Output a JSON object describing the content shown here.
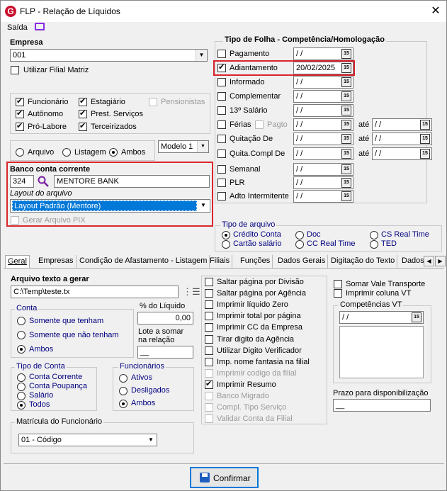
{
  "window": {
    "title": "FLP - Relação de Líquidos",
    "saida_label": "Saída"
  },
  "empresa": {
    "label": "Empresa",
    "value": "001",
    "filial_matriz": "Utilizar Filial Matriz"
  },
  "tipos": {
    "funcionario": "Funcionário",
    "autonomo": "Autônomo",
    "pro_labore": "Pró-Labore",
    "estagiario": "Estagiário",
    "prest_servicos": "Prest. Serviços",
    "terceirizados": "Terceirizados",
    "pensionistas": "Pensionistas"
  },
  "formato": {
    "arquivo": "Arquivo",
    "listagem": "Listagem",
    "ambos": "Ambos",
    "modelo": "Modelo 1"
  },
  "banco": {
    "title": "Banco conta corrente",
    "codigo": "324",
    "nome": "MENTORE BANK",
    "layout_label": "Layout do arquivo",
    "layout_value": "Layout Padrão (Mentore)",
    "gerar_pix": "Gerar Arquivo PIX"
  },
  "folha": {
    "title": "Tipo de Folha  -  Competência/Homologação",
    "ate": "até",
    "empty_date": " /  /",
    "rows": [
      {
        "label": "Pagamento",
        "date": " /  /",
        "checked": false
      },
      {
        "label": "Adiantamento",
        "date": "20/02/2025",
        "checked": true
      },
      {
        "label": "Informado",
        "date": " /  /",
        "checked": false
      },
      {
        "label": "Complementar",
        "date": " /  /",
        "checked": false
      },
      {
        "label": "13º Salário",
        "date": " /  /",
        "checked": false
      },
      {
        "label": "Férias",
        "date": " /  /",
        "checked": false,
        "extra": "Pagto"
      },
      {
        "label": "Quitação De",
        "date": " /  /",
        "checked": false
      },
      {
        "label": "Quita.Compl De",
        "date": " /  /",
        "checked": false
      },
      {
        "label": "Semanal",
        "date": " /  /",
        "checked": false
      },
      {
        "label": "PLR",
        "date": " /  /",
        "checked": false
      },
      {
        "label": "Adto Intermitente",
        "date": " /  /",
        "checked": false
      }
    ]
  },
  "tipo_arquivo": {
    "title": "Tipo de arquivo",
    "credito": "Crédito Conta",
    "cartao": "Cartão salário",
    "doc": "Doc",
    "cc_real": "CC Real Time",
    "cs_real": "CS Real Time",
    "ted": "TED"
  },
  "tabs": [
    "Geral",
    "Empresas",
    "Condição de Afastamento - Listagem",
    "Filiais",
    "Funções",
    "Dados Gerais",
    "Digitação do Texto",
    "Dados"
  ],
  "geral": {
    "arquivo_label": "Arquivo texto a gerar",
    "arquivo_value": "C:\\Temp\\teste.tx",
    "conta_title": "Conta",
    "conta_opts": [
      "Somente que tenham",
      "Somente que não tenham",
      "Ambos"
    ],
    "pct_label": "% do Líquido",
    "pct_value": "0,00",
    "lote_label": "Lote a somar na relação",
    "lote_value": "__",
    "tipo_conta_title": "Tipo de Conta",
    "tipo_conta_opts": [
      "Conta Corrente",
      "Conta Poupança",
      "Salário",
      "Todos"
    ],
    "funcionarios_title": "Funcionários",
    "func_opts": [
      "Ativos",
      "Desligados",
      "Ambos"
    ],
    "matricula_title": "Matrícula do Funcionário",
    "matricula_value": "01 - Código",
    "opts": [
      {
        "label": "Saltar página por Divisão",
        "checked": false,
        "enabled": true
      },
      {
        "label": "Saltar página por Agência",
        "checked": false,
        "enabled": true
      },
      {
        "label": "Imprimir líquido Zero",
        "checked": false,
        "enabled": true
      },
      {
        "label": "Imprimir total por página",
        "checked": false,
        "enabled": true
      },
      {
        "label": "Imprimir CC da Empresa",
        "checked": false,
        "enabled": true
      },
      {
        "label": "Tirar digito da Agência",
        "checked": false,
        "enabled": true
      },
      {
        "label": "Utilizar Digito Verificador",
        "checked": false,
        "enabled": true
      },
      {
        "label": "Imp. nome fantasia na filial",
        "checked": false,
        "enabled": true
      },
      {
        "label": "Imprimir codigo da filial",
        "checked": false,
        "enabled": false
      },
      {
        "label": "Imprimir Resumo",
        "checked": true,
        "enabled": true
      },
      {
        "label": "Banco Migrado",
        "checked": false,
        "enabled": false
      },
      {
        "label": "Compl. Tipo Serviço",
        "checked": false,
        "enabled": false
      },
      {
        "label": "Validar Conta da Filial",
        "checked": false,
        "enabled": false
      }
    ],
    "somar_vt": "Somar Vale Transporte",
    "imprimir_vt": "Imprimir coluna VT",
    "competencias_title": "Competências VT",
    "competencia_value": " /  /",
    "prazo_label": "Prazo para disponibilização",
    "prazo_value": "__"
  },
  "confirm": "Confirmar"
}
